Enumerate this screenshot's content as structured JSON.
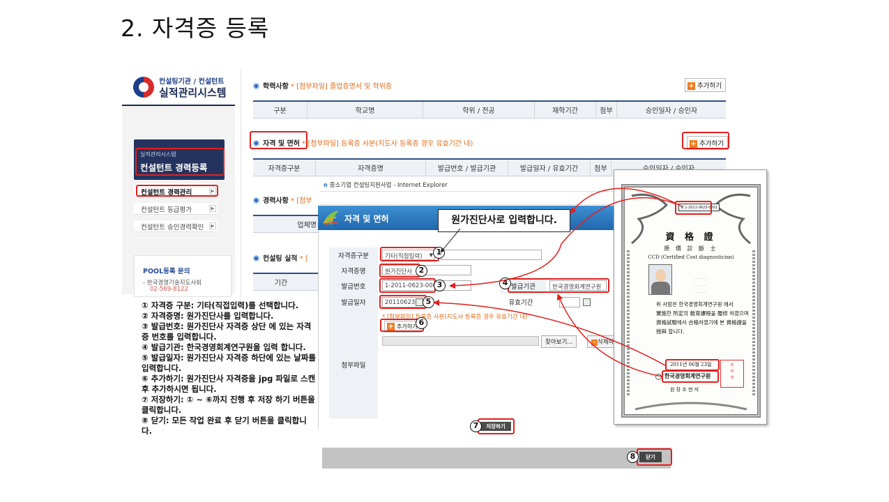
{
  "slide_title": "2. 자격증 등록",
  "logo": {
    "sub": "컨설팅기관 / 컨설턴트",
    "main": "실적관리시스템"
  },
  "sidebar": {
    "banner_small": "실적관리시스템",
    "banner_big": "컨설턴트 경력등록",
    "items": [
      {
        "label": "컨설턴트 경력관리"
      },
      {
        "label": "컨설턴트 등급평가"
      },
      {
        "label": "컨설턴트 승인경력확인"
      }
    ],
    "pool_title": "POOL등록 문의",
    "pool_org": "- 한국경영기술지도사회",
    "pool_tel": "02-569-8122"
  },
  "sections": {
    "education": {
      "title": "학력사항",
      "note": "* [첨부파일] 졸업증명서 및 학위증",
      "add_label": "추가하기",
      "columns": [
        "구분",
        "학교명",
        "학위 / 전공",
        "재학기간",
        "첨부",
        "승인일자 / 승인자"
      ]
    },
    "license": {
      "title": "자격 및 면허",
      "note": "* [첨부파일] 등록증 사본(지도사 등록증 경우 유효기간 내)",
      "add_label": "추가하기",
      "columns": [
        "자격증구분",
        "자격증명",
        "발급번호 / 발급기관",
        "발급일자 / 유효기간",
        "첨부",
        "승인일자 / 승인자"
      ]
    },
    "career": {
      "title": "경력사항",
      "note": "* [첨부",
      "col": "업체명"
    },
    "consulting": {
      "title": "컨설팅 실적",
      "note": "* [",
      "col": "기간"
    }
  },
  "ie_window": {
    "title": "중소기업 컨설팅지원사업 - Internet Explorer",
    "dialog_title": "자격 및 면허",
    "callout": "원가진단사로 입력합니다."
  },
  "form": {
    "type_label": "자격증구분",
    "type_value": "기타(직접입력)",
    "name_label": "자격증명",
    "name_value": "원가진단사",
    "number_label": "발급번호",
    "number_value": "1-2011-0623-0001",
    "issuer_label": "발급기관",
    "issuer_value": "한국경영회계연구원",
    "date_label": "발급일자",
    "date_value": "20110623",
    "valid_label": "유효기간",
    "attach_note": "* [첨부파일] 등록증 사본(지도사 등록증 경우 유효기간 내)",
    "attach_add": "추가하기",
    "browse_label": "찾아보기...",
    "delete_label": "삭제하",
    "attach_label": "첨부파일",
    "save_label": "저장하기",
    "close_label": "닫기"
  },
  "steps": [
    "1",
    "2",
    "3",
    "4",
    "5",
    "6",
    "7",
    "8"
  ],
  "certificate": {
    "number": "제 1-2011-0623-0001",
    "title": "資 格 證",
    "name_cn": "原 價 診 斷 士",
    "name_en": "CCD (Certified Cost diagnostician)",
    "body": [
      "위 사람은 한국경영회계연구원 에서",
      "實施한 所定의 敎育課程을 履修 하였으며",
      "資格試驗에서 合格하였기에 본 資格證을",
      "授與 합니다."
    ],
    "date": "2011년 06월 23일",
    "org": "한국경영회계연구원",
    "head": "원 장  조 현 석"
  },
  "instructions": [
    "① 자격증 구분: 기타(직접입력)를 선택합니다.",
    "② 자격증명: 원가진단사를 입력합니다.",
    "③ 발급번호: 원가진단사 자격증 상단 에 있는 자격증 번호를 입력합니다.",
    "④ 발급기관: 한국경영회계연구원을 입력 합니다.",
    "⑤ 발급일자: 원가진단사 자격증 하단에 있는 날짜를 입력합니다.",
    "⑥ 추가하기: 원가진단사 자격증을 jpg 파일로 스캔 후 추가하시면 됩니다.",
    "⑦ 저장하기: ① ~ ⑥까지 진행 후 저장 하기 버튼을 클릭합니다.",
    "⑧ 닫기: 모든 작업 완료 후 닫기 버튼을 클릭합니다."
  ],
  "colors": {
    "highlight": "#e0201e",
    "accent_orange": "#ef7c1f",
    "navy": "#23335e",
    "header_line": "#2f4f88"
  }
}
